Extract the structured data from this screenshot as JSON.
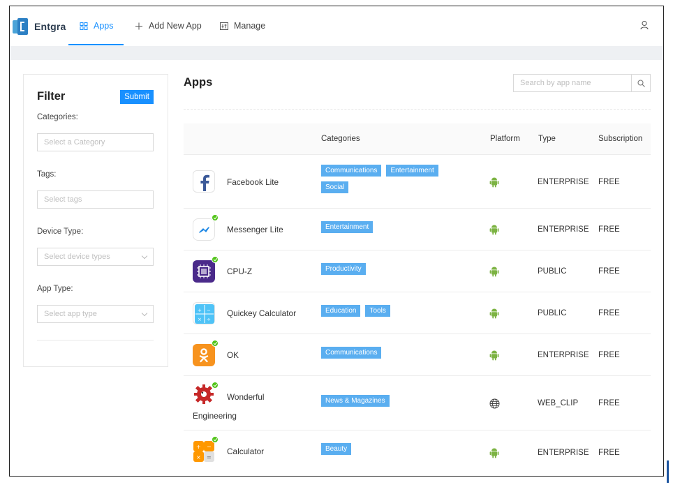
{
  "header": {
    "brand": "Entgra",
    "nav": [
      {
        "label": "Apps",
        "icon": "grid-icon"
      },
      {
        "label": "Add New App",
        "icon": "plus-icon"
      },
      {
        "label": "Manage",
        "icon": "control-icon"
      }
    ]
  },
  "filter": {
    "title": "Filter",
    "submit_label": "Submit",
    "categories_label": "Categories:",
    "categories_placeholder": "Select a Category",
    "tags_label": "Tags:",
    "tags_placeholder": "Select tags",
    "device_type_label": "Device Type:",
    "device_type_placeholder": "Select device types",
    "app_type_label": "App Type:",
    "app_type_placeholder": "Select app type"
  },
  "main": {
    "title": "Apps",
    "search_placeholder": "Search by app name",
    "columns": [
      "Categories",
      "Platform",
      "Type",
      "Subscription"
    ]
  },
  "apps": [
    {
      "name": "Facebook Lite",
      "categories": [
        "Communications",
        "Entertainment",
        "Social"
      ],
      "platform": "android",
      "type": "ENTERPRISE",
      "subscription": "FREE",
      "installed": false
    },
    {
      "name": "Messenger Lite",
      "categories": [
        "Entertainment"
      ],
      "platform": "android",
      "type": "ENTERPRISE",
      "subscription": "FREE",
      "installed": true
    },
    {
      "name": "CPU-Z",
      "categories": [
        "Productivity"
      ],
      "platform": "android",
      "type": "PUBLIC",
      "subscription": "FREE",
      "installed": true
    },
    {
      "name": "Quickey Calculator",
      "categories": [
        "Education",
        "Tools"
      ],
      "platform": "android",
      "type": "PUBLIC",
      "subscription": "FREE",
      "installed": false
    },
    {
      "name": "OK",
      "categories": [
        "Communications"
      ],
      "platform": "android",
      "type": "ENTERPRISE",
      "subscription": "FREE",
      "installed": true
    },
    {
      "name_line1": "Wonderful",
      "name_line2": "Engineering",
      "categories": [
        "News & Magazines"
      ],
      "platform": "web",
      "type": "WEB_CLIP",
      "subscription": "FREE",
      "installed": true
    },
    {
      "name": "Calculator",
      "categories": [
        "Beauty"
      ],
      "platform": "android",
      "type": "ENTERPRISE",
      "subscription": "FREE",
      "installed": true
    }
  ],
  "colors": {
    "accent": "#1890ff",
    "tag": "#5aaef0",
    "android": "#7cb342",
    "installed": "#52c41a"
  }
}
